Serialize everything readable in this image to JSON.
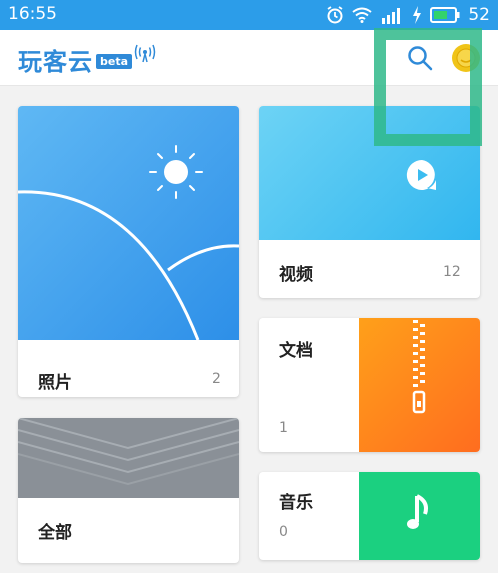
{
  "status_bar": {
    "time": "16:55",
    "battery": "52",
    "icons": [
      "alarm-icon",
      "wifi-icon",
      "signal-icon",
      "charging-icon",
      "battery-icon"
    ]
  },
  "app_bar": {
    "title": "玩客云",
    "badge": "beta",
    "icons": [
      "cast-icon",
      "search-icon",
      "avatar"
    ]
  },
  "categories": {
    "photos": {
      "label": "照片",
      "count": "2"
    },
    "all": {
      "label": "全部"
    },
    "videos": {
      "label": "视频",
      "count": "12"
    },
    "documents": {
      "label": "文档",
      "count": "1"
    },
    "music": {
      "label": "音乐",
      "count": "0"
    }
  },
  "colors": {
    "primary": "#2f8ad8",
    "status_bar": "#2c9de9",
    "photo": "#3aa2ef",
    "video": "#4cc4f2",
    "document": "#ff8a1c",
    "music": "#1bd080",
    "highlight": "#2fb88a"
  }
}
